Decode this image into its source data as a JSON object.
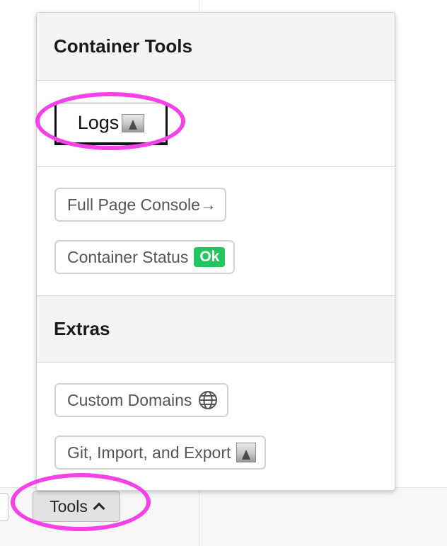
{
  "container_tools": {
    "header": "Container Tools",
    "logs_label": "Logs",
    "logs_icon": "image-icon",
    "full_page_console_label": "Full Page Console→",
    "container_status_label": "Container Status",
    "status_badge": "Ok",
    "status_color": "#22c55e"
  },
  "extras": {
    "header": "Extras",
    "custom_domains_label": "Custom Domains",
    "custom_domains_icon": "globe-icon",
    "git_label": "Git, Import, and Export",
    "git_icon": "image-icon"
  },
  "bottom_bar": {
    "tools_label": "Tools",
    "tools_icon": "chevron-up-icon"
  },
  "highlight_color": "#f542e8"
}
